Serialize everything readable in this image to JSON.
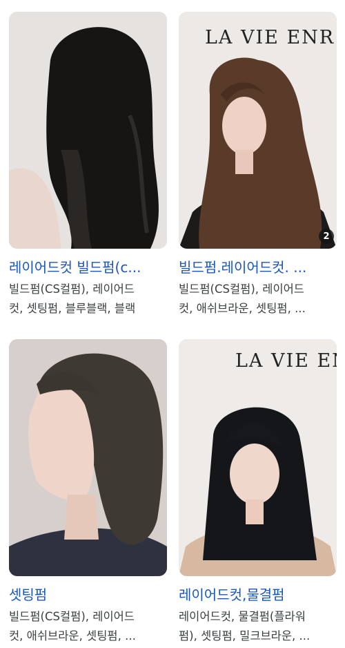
{
  "results": [
    {
      "title": "레이어드컷 빌드펌(c...",
      "desc_line1": "빌드펌(CS컬펌), 레이어드",
      "desc_line2": "컷, 셋팅펌, 블루블랙, 블랙"
    },
    {
      "title": "빌드펌.레이어드컷. ...",
      "desc_line1": "빌드펌(CS컬펌), 레이어드",
      "desc_line2": "컷, 애쉬브라운, 셋팅펌, ...",
      "image_text": "LA VIE ENR",
      "badge": "2"
    },
    {
      "title": "셋팅펌",
      "desc_line1": "빌드펌(CS컬펌), 레이어드",
      "desc_line2": "컷, 애쉬브라운, 셋팅펌, ..."
    },
    {
      "title": "레이어드컷,물결펌",
      "desc_line1": "레이어드컷, 물결펌(플라워",
      "desc_line2": "펌), 셋팅펌, 밀크브라운, ...",
      "image_text": "LA VIE ENR"
    }
  ]
}
